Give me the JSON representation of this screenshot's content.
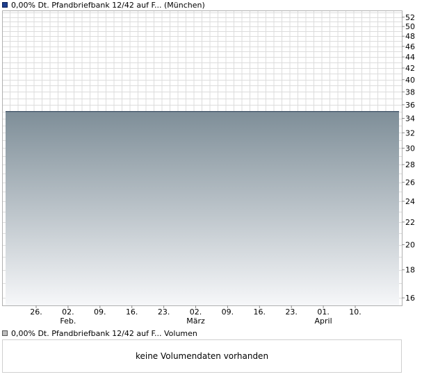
{
  "legend": {
    "price_label": "0,00% Dt. Pfandbriefbank 12/42 auf F... (München)",
    "volume_label": "0,00% Dt. Pfandbriefbank 12/42 auf F... Volumen",
    "price_color": "#1f3f8f",
    "volume_color": "#bdbdbd"
  },
  "volume_message": "keine Volumendaten vorhanden",
  "colors": {
    "grid": "#dcdcdc",
    "line": "#3e5266",
    "area_top": "#7e8e98",
    "area_bottom": "#f6f7f9",
    "axis": "#b0b0b0"
  },
  "chart_data": {
    "type": "area",
    "title": "",
    "xlabel": "",
    "ylabel": "",
    "ylim": [
      15.5,
      53.5
    ],
    "y_scale": "log",
    "y_ticks": [
      16,
      18,
      20,
      22,
      24,
      26,
      28,
      30,
      32,
      34,
      36,
      38,
      40,
      42,
      44,
      46,
      48,
      50,
      52
    ],
    "x_ticks": [
      {
        "day": "26.",
        "month": ""
      },
      {
        "day": "02.",
        "month": "Feb."
      },
      {
        "day": "09.",
        "month": ""
      },
      {
        "day": "16.",
        "month": ""
      },
      {
        "day": "23.",
        "month": ""
      },
      {
        "day": "02.",
        "month": "März"
      },
      {
        "day": "09.",
        "month": ""
      },
      {
        "day": "16.",
        "month": ""
      },
      {
        "day": "23.",
        "month": ""
      },
      {
        "day": "01.",
        "month": "April"
      },
      {
        "day": "10.",
        "month": ""
      }
    ],
    "series": [
      {
        "values": [
          35,
          35,
          35,
          35,
          35,
          35,
          35,
          35,
          35,
          35,
          35,
          35,
          35
        ]
      }
    ],
    "grid": true,
    "legend": "top-left"
  }
}
